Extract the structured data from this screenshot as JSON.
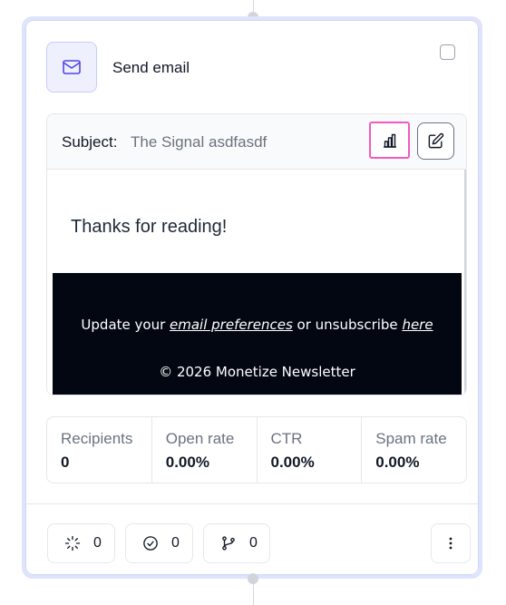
{
  "node": {
    "title": "Send email",
    "subject_label": "Subject:",
    "subject_value": "The Signal asdfasdf"
  },
  "preview": {
    "message": "Thanks for reading!",
    "footer_prefix": "Update your ",
    "footer_link_preferences": "email preferences",
    "footer_middle": " or unsubscribe ",
    "footer_link_here": "here",
    "copyright": "© 2026 Monetize Newsletter"
  },
  "stats": [
    {
      "label": "Recipients",
      "value": "0"
    },
    {
      "label": "Open rate",
      "value": "0.00%"
    },
    {
      "label": "CTR",
      "value": "0.00%"
    },
    {
      "label": "Spam rate",
      "value": "0.00%"
    }
  ],
  "footer_counts": {
    "in_progress": "0",
    "completed": "0",
    "branches": "0"
  },
  "colors": {
    "accent_border": "#dfe3fb",
    "highlight": "#f15bbf",
    "icon_accent": "#4f46e5",
    "footer_bg": "#030712"
  },
  "icons": [
    "mail-icon",
    "bar-chart-icon",
    "edit-icon",
    "loader-icon",
    "check-circle-icon",
    "git-branch-icon",
    "more-vertical-icon"
  ]
}
